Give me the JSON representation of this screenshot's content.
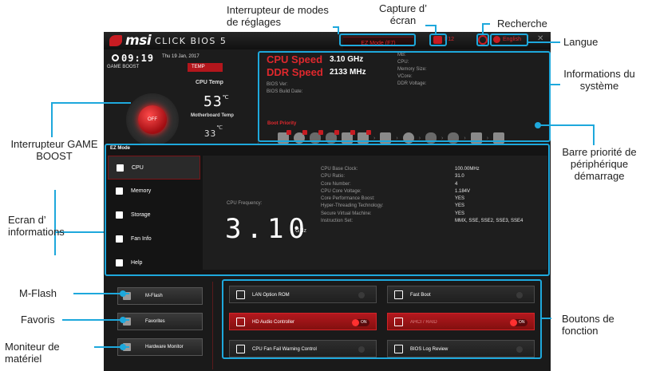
{
  "bios": {
    "brand": "msi",
    "product": "CLICK BIOS 5",
    "ez_mode_button": "EZ Mode (F7)",
    "screenshot_key": "F12",
    "language": "English",
    "clock": "09:19",
    "date": "Thu 19 Jan, 2017",
    "game_boost_label": "GAME BOOST",
    "temp_tab": "TEMP",
    "knob_label": "OFF",
    "cpu_temp_label": "CPU Temp",
    "cpu_temp": "53",
    "temp_unit": "℃",
    "mb_temp_label": "Motherboard Temp",
    "mb_temp": "33",
    "help_q": "?",
    "cpu_speed_label": "CPU Speed",
    "cpu_speed_value": "3.10 GHz",
    "ddr_speed_label": "DDR Speed",
    "ddr_speed_value": "2133 MHz",
    "bios_ver_label": "BIOS Ver:",
    "bios_build_label": "BIOS Build Date:",
    "sys_fields": [
      "MB:",
      "CPU:",
      "Memory Size:",
      "VCore:",
      "DDR Voltage:"
    ],
    "boot_priority_label": "Boot Priority",
    "ez_mode_label": "EZ Mode",
    "nav": [
      "CPU",
      "Memory",
      "Storage",
      "Fan Info",
      "Help"
    ],
    "cpu_freq_label": "CPU Frequency:",
    "cpu_freq": "3.10",
    "cpu_freq_unit": "GHz",
    "spec_keys": [
      "CPU Base Clock:",
      "CPU Ratio:",
      "Core Number:",
      "CPU Core Voltage:",
      "Core Performance Boost:",
      "Hyper-Threading Technology:",
      "Secure Virtual Machine:",
      "Instruction Set:"
    ],
    "spec_values": [
      "100.00MHz",
      "31.0",
      "4",
      "1.184V",
      "YES",
      "YES",
      "YES",
      "MMX, SSE, SSE2, SSE3, SSE4"
    ],
    "side_buttons": [
      "M-Flash",
      "Favorites",
      "Hardware Monitor"
    ],
    "functions": {
      "lan_option_rom": "LAN Option ROM",
      "fast_boot": "Fast Boot",
      "hd_audio": "HD Audio Controller",
      "ahci_raid": "AHCI / RAID",
      "cpu_fan_warning": "CPU Fan Fail Warning Control",
      "bios_log": "BIOS Log Review",
      "on_label": "ON"
    }
  },
  "callouts": {
    "settings_switch": "Interrupteur de modes de réglages",
    "capture": "Capture d’ écran",
    "recherche": "Recherche",
    "langue": "Langue",
    "sys_info": "Informations du système",
    "game_boost": "Interrupteur GAME BOOST",
    "boot_bar": "Barre priorité de périphérique démarrage",
    "ecran": "Ecran d’ informations",
    "mflash": "M-Flash",
    "favoris": "Favoris",
    "moniteur": "Moniteur de matériel",
    "boutons": "Boutons de fonction"
  },
  "colors": {
    "accent": "#1ea8dc",
    "msi_red": "#c71c22"
  }
}
